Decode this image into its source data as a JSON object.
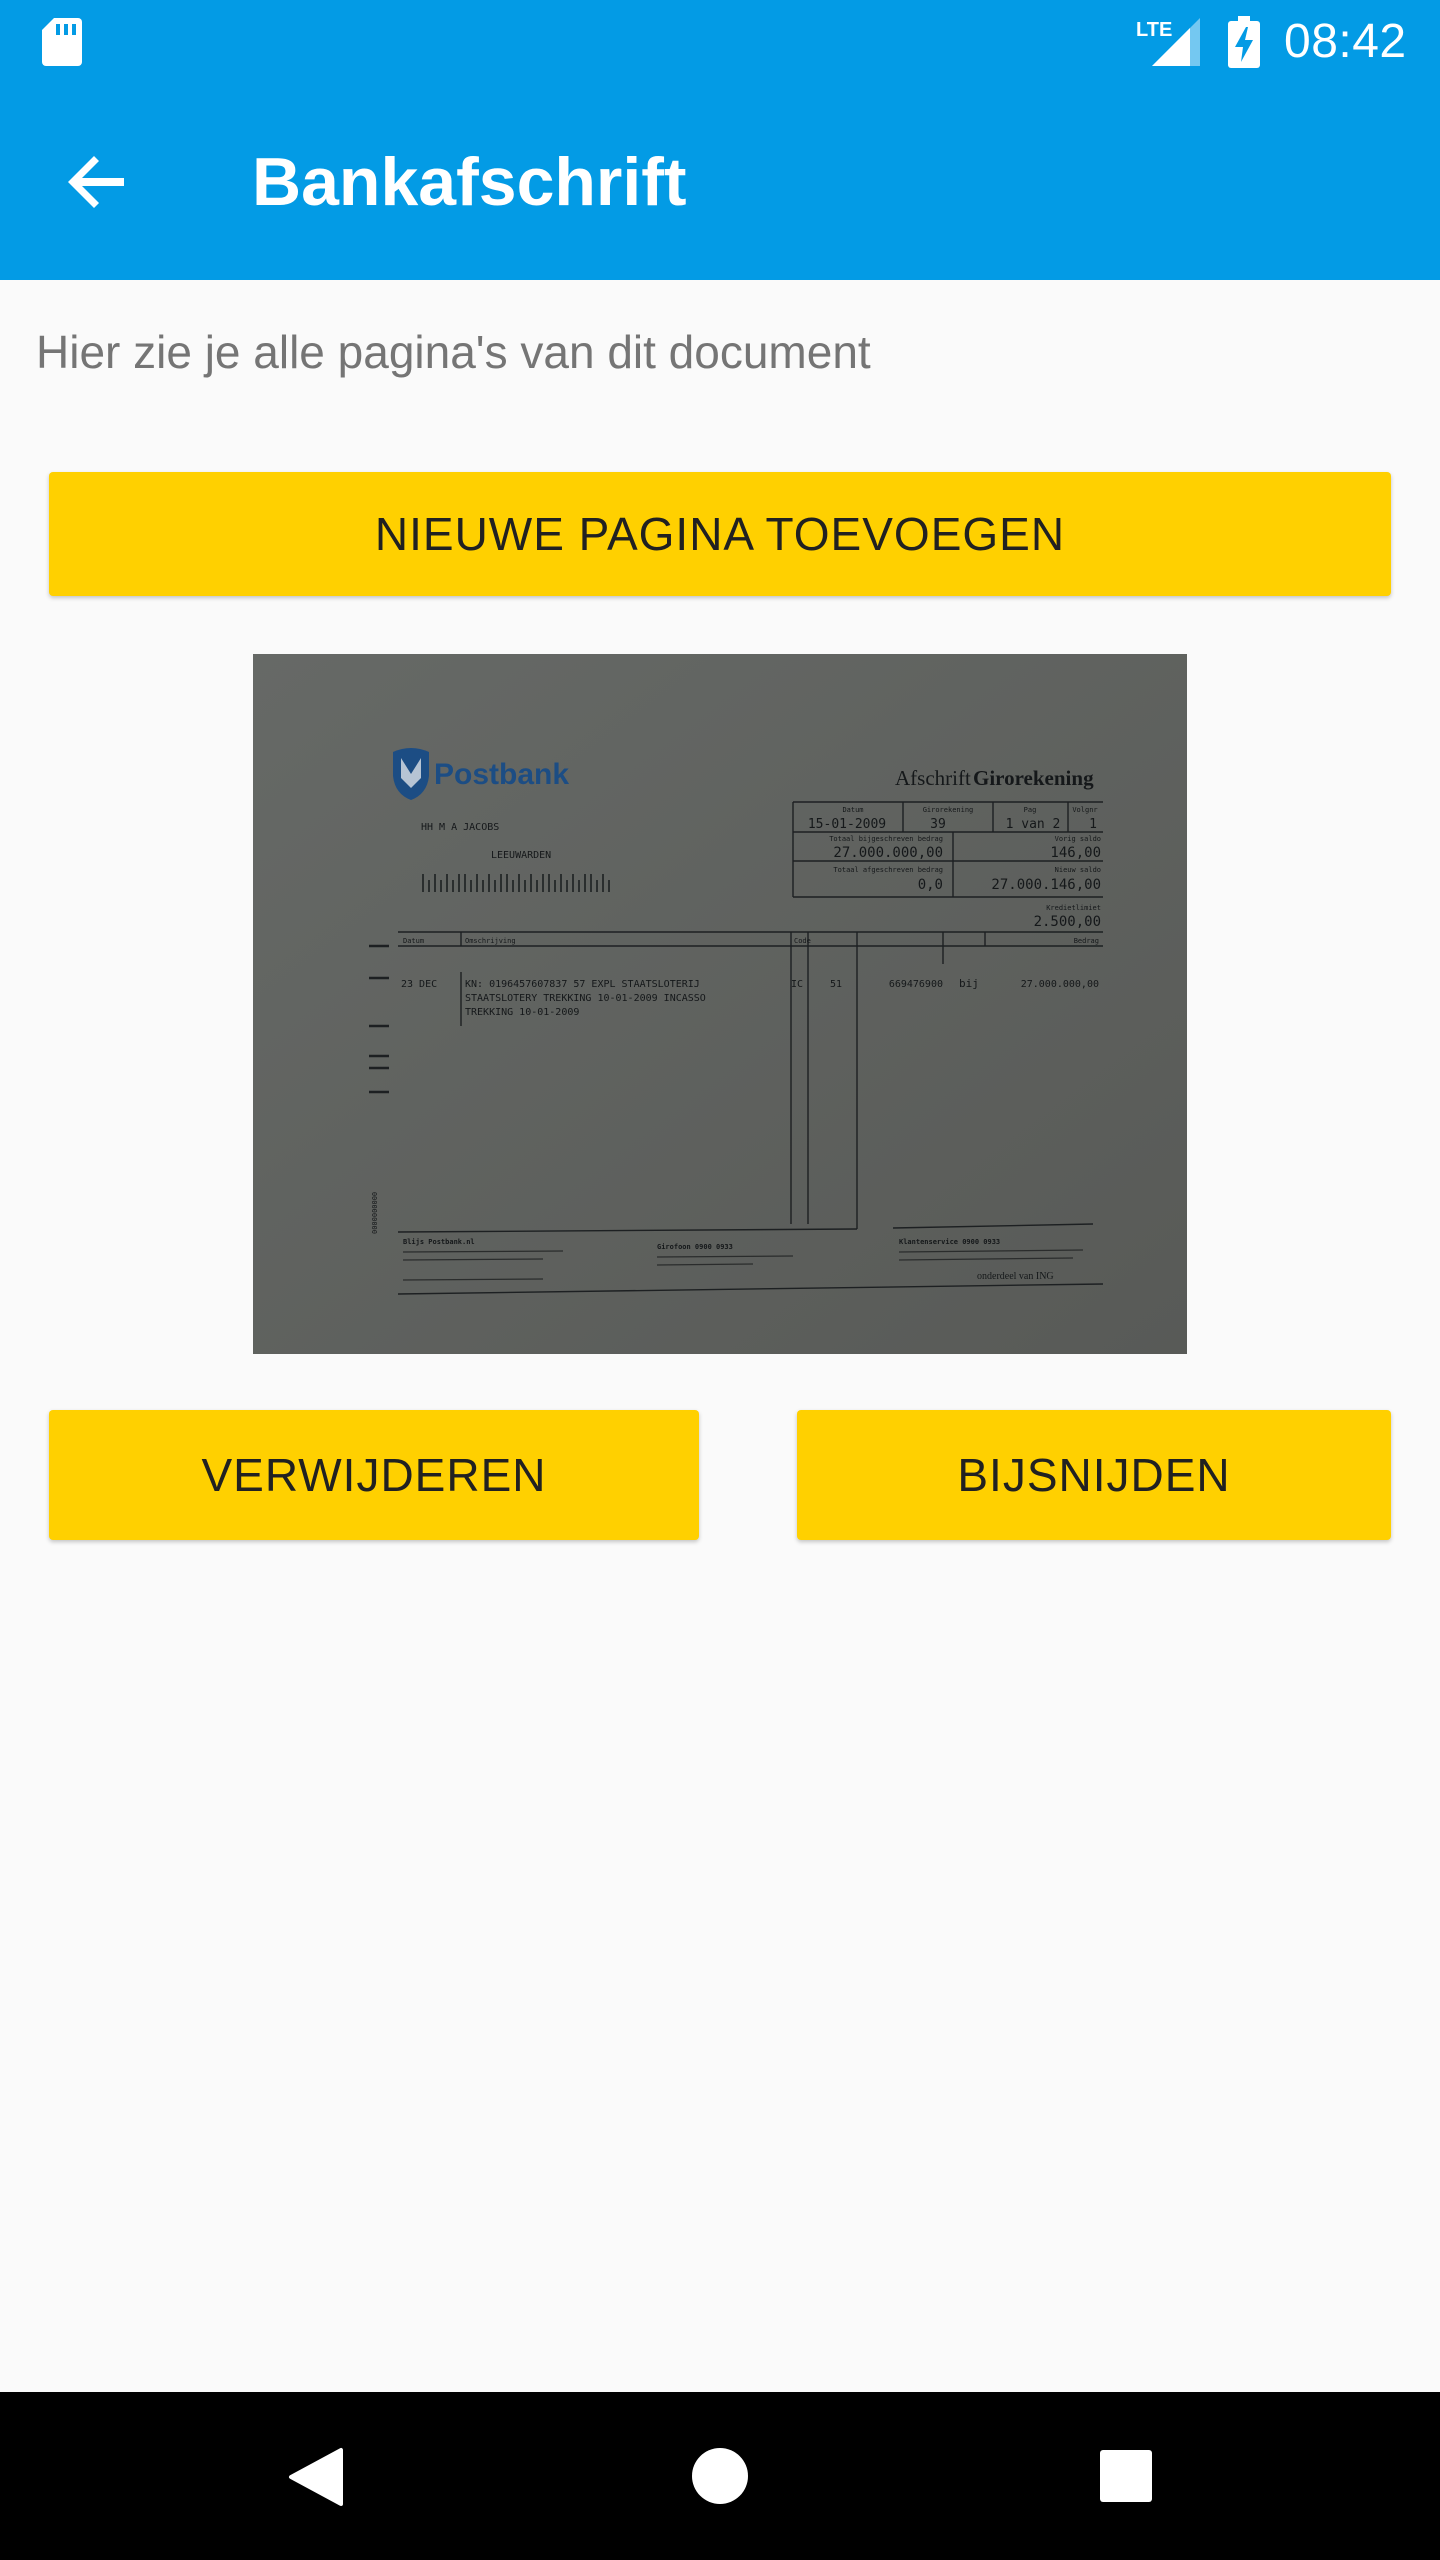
{
  "status_bar": {
    "time": "08:42",
    "network": "LTE",
    "icons": [
      "sd-card-icon",
      "lte-signal-icon",
      "battery-charging-icon"
    ]
  },
  "app_bar": {
    "back_icon": "arrow-back-icon",
    "title": "Bankafschrift"
  },
  "main": {
    "subtitle": "Hier zie je alle pagina's van dit document",
    "add_page_label": "NIEUWE PAGINA TOEVOEGEN",
    "delete_label": "VERWIJDEREN",
    "crop_label": "BIJSNIJDEN"
  },
  "document": {
    "bank_name": "Postbank",
    "doc_type_prefix": "Afschrift",
    "doc_type": "Girorekening",
    "header_labels": [
      "Datum",
      "Girorekening",
      "Pag",
      "Volgnr"
    ],
    "date": "15-01-2009",
    "account": "39",
    "page": "1 van 2",
    "seq": "1",
    "total_credit_label": "Totaal bijgeschreven bedrag",
    "total_credit": "27.000.000,00",
    "old_balance_label": "Vorig saldo",
    "old_balance": "146,00",
    "total_debit_label": "Totaal afgeschreven bedrag",
    "total_debit": "0,0",
    "new_balance_label": "Nieuw saldo",
    "new_balance": "27.000.146,00",
    "credit_limit_label": "Kredietlimiet",
    "credit_limit": "2.500,00",
    "holder": "HH M A JACOBS",
    "city": "LEEUWARDEN",
    "columns": [
      "Datum",
      "Omschrijving",
      "Code",
      "Bedrag"
    ],
    "row_date": "23 DEC",
    "row_desc_lines": [
      "KN: 0196457607837 57 EXPL STAATSLOTERIJ",
      "STAATSLOTERY TREKKING 10-01-2009 INCASSO",
      "TREKKING 10-01-2009"
    ],
    "row_code": "IC",
    "row_nr": "51",
    "row_account": "669476900",
    "row_side": "bij",
    "row_amount": "27.000.000,00",
    "footer_left": "Blijs Postbank.nl",
    "footer_mid": "Girofoon 0900 0933",
    "footer_right": "Klantenservice 0900 0933",
    "footer_sign": "onderdeel van ING",
    "colors": {
      "appbar": "#039be5",
      "button": "#ffd000",
      "postbank_blue": "#1c4d84"
    }
  },
  "nav_bar": {
    "icons": [
      "nav-back-icon",
      "nav-home-icon",
      "nav-recents-icon"
    ]
  }
}
